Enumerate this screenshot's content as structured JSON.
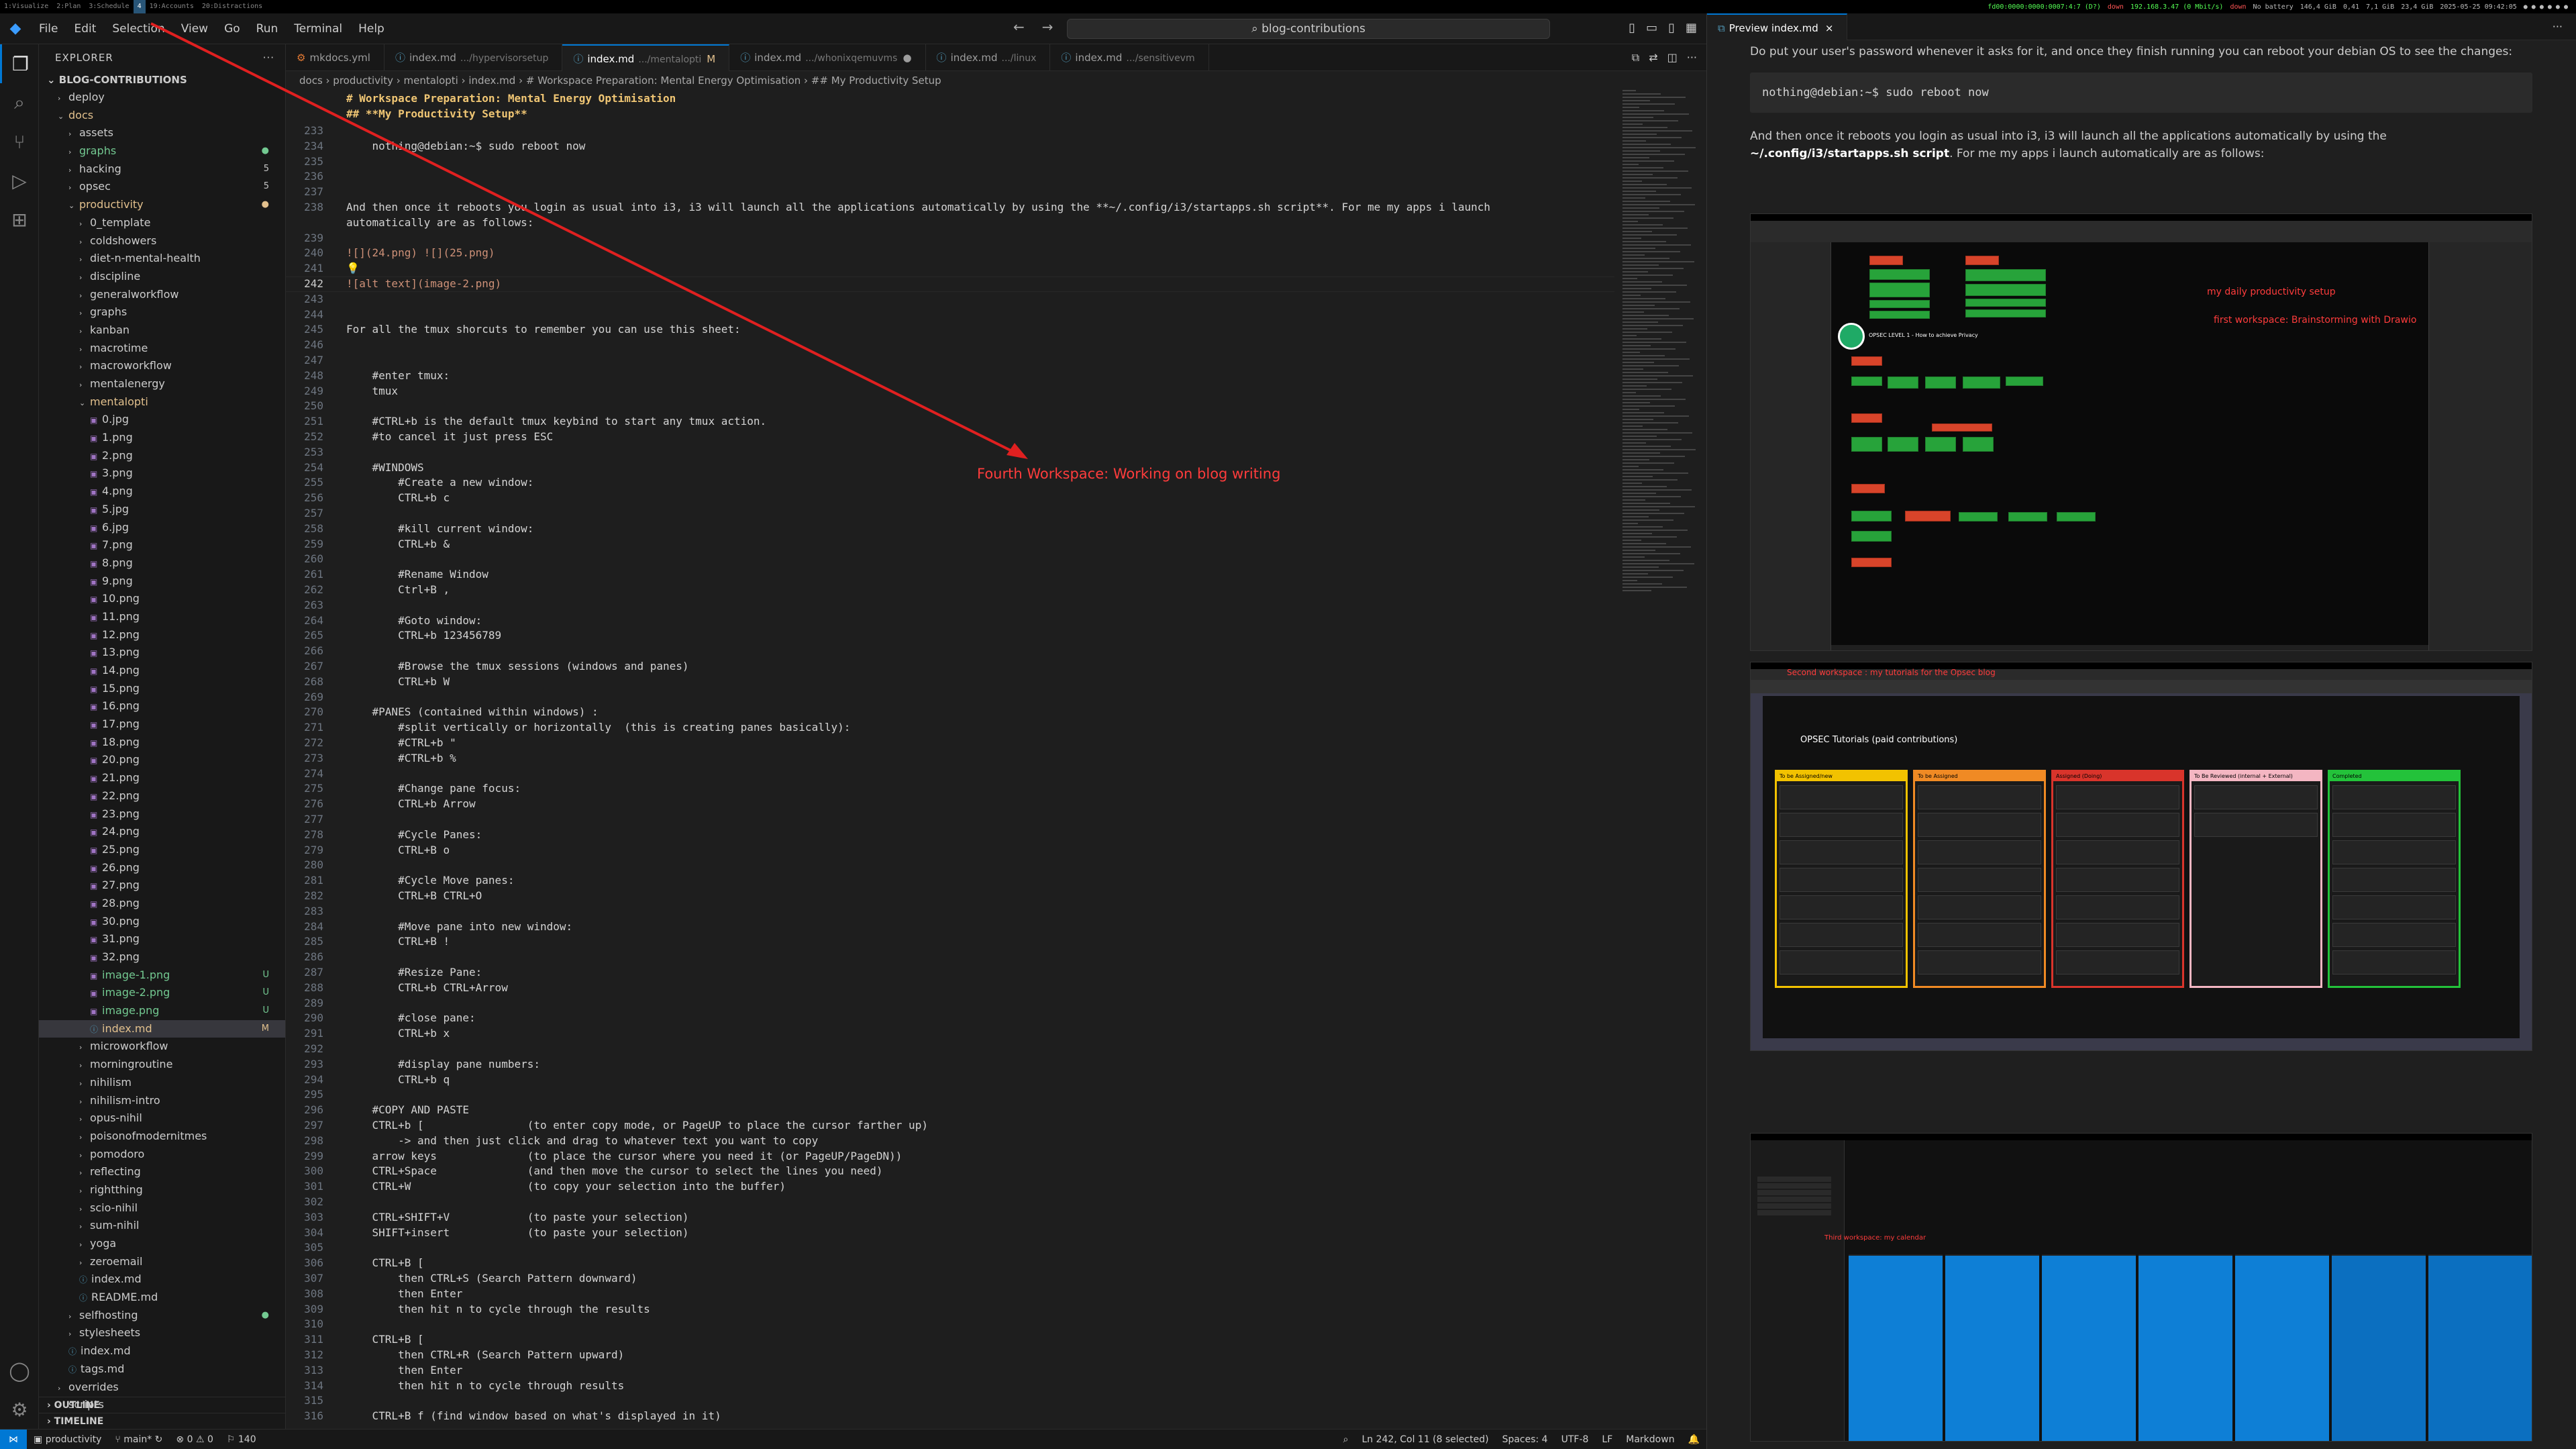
{
  "i3bar": {
    "workspaces": [
      {
        "label": "1:Visualize"
      },
      {
        "label": "2:Plan"
      },
      {
        "label": "3:Schedule"
      },
      {
        "label": "4",
        "active": true
      },
      {
        "label": "19:Accounts"
      },
      {
        "label": "20:Distractions"
      }
    ],
    "status": {
      "ip_down": "fd00:0000:0000:0007:4:7 (D?)",
      "down": "down",
      "ip_up": "192.168.3.47 (0 Mbit/s)",
      "down2": "down",
      "battery": "No battery",
      "disk": "146,4 GiB",
      "load": "0,41",
      "mem1": "7,1 GiB",
      "mem2": "23,4 GiB",
      "datetime": "2025-05-25 09:42:05"
    }
  },
  "titlebar": {
    "menu": [
      "File",
      "Edit",
      "Selection",
      "View",
      "Go",
      "Run",
      "Terminal",
      "Help"
    ],
    "command_center": "blog-contributions"
  },
  "sidebar": {
    "title": "EXPLORER",
    "root": "BLOG-CONTRIBUTIONS",
    "items": [
      {
        "label": "deploy",
        "depth": 1,
        "type": "folder",
        "open": false
      },
      {
        "label": "docs",
        "depth": 1,
        "type": "folder",
        "open": true,
        "color": "mod"
      },
      {
        "label": "assets",
        "depth": 2,
        "type": "folder",
        "open": false
      },
      {
        "label": "graphs",
        "depth": 2,
        "type": "folder",
        "open": false,
        "color": "ok",
        "badge": "●"
      },
      {
        "label": "hacking",
        "depth": 2,
        "type": "folder",
        "open": false,
        "badge": "5"
      },
      {
        "label": "opsec",
        "depth": 2,
        "type": "folder",
        "open": false,
        "badge": "5"
      },
      {
        "label": "productivity",
        "depth": 2,
        "type": "folder",
        "open": true,
        "color": "mod",
        "badge": "●"
      },
      {
        "label": "0_template",
        "depth": 3,
        "type": "folder",
        "open": false
      },
      {
        "label": "coldshowers",
        "depth": 3,
        "type": "folder",
        "open": false
      },
      {
        "label": "diet-n-mental-health",
        "depth": 3,
        "type": "folder",
        "open": false
      },
      {
        "label": "discipline",
        "depth": 3,
        "type": "folder",
        "open": false
      },
      {
        "label": "generalworkflow",
        "depth": 3,
        "type": "folder",
        "open": false
      },
      {
        "label": "graphs",
        "depth": 3,
        "type": "folder",
        "open": false
      },
      {
        "label": "kanban",
        "depth": 3,
        "type": "folder",
        "open": false
      },
      {
        "label": "macrotime",
        "depth": 3,
        "type": "folder",
        "open": false
      },
      {
        "label": "macroworkflow",
        "depth": 3,
        "type": "folder",
        "open": false
      },
      {
        "label": "mentalenergy",
        "depth": 3,
        "type": "folder",
        "open": false
      },
      {
        "label": "mentalopti",
        "depth": 3,
        "type": "folder",
        "open": true,
        "color": "mod"
      },
      {
        "label": "0.jpg",
        "depth": 4,
        "type": "img"
      },
      {
        "label": "1.png",
        "depth": 4,
        "type": "img"
      },
      {
        "label": "2.png",
        "depth": 4,
        "type": "img"
      },
      {
        "label": "3.png",
        "depth": 4,
        "type": "img"
      },
      {
        "label": "4.png",
        "depth": 4,
        "type": "img"
      },
      {
        "label": "5.jpg",
        "depth": 4,
        "type": "img"
      },
      {
        "label": "6.jpg",
        "depth": 4,
        "type": "img"
      },
      {
        "label": "7.png",
        "depth": 4,
        "type": "img"
      },
      {
        "label": "8.png",
        "depth": 4,
        "type": "img"
      },
      {
        "label": "9.png",
        "depth": 4,
        "type": "img"
      },
      {
        "label": "10.png",
        "depth": 4,
        "type": "img"
      },
      {
        "label": "11.png",
        "depth": 4,
        "type": "img"
      },
      {
        "label": "12.png",
        "depth": 4,
        "type": "img"
      },
      {
        "label": "13.png",
        "depth": 4,
        "type": "img"
      },
      {
        "label": "14.png",
        "depth": 4,
        "type": "img"
      },
      {
        "label": "15.png",
        "depth": 4,
        "type": "img"
      },
      {
        "label": "16.png",
        "depth": 4,
        "type": "img"
      },
      {
        "label": "17.png",
        "depth": 4,
        "type": "img"
      },
      {
        "label": "18.png",
        "depth": 4,
        "type": "img"
      },
      {
        "label": "20.png",
        "depth": 4,
        "type": "img"
      },
      {
        "label": "21.png",
        "depth": 4,
        "type": "img"
      },
      {
        "label": "22.png",
        "depth": 4,
        "type": "img"
      },
      {
        "label": "23.png",
        "depth": 4,
        "type": "img"
      },
      {
        "label": "24.png",
        "depth": 4,
        "type": "img"
      },
      {
        "label": "25.png",
        "depth": 4,
        "type": "img"
      },
      {
        "label": "26.png",
        "depth": 4,
        "type": "img"
      },
      {
        "label": "27.png",
        "depth": 4,
        "type": "img"
      },
      {
        "label": "28.png",
        "depth": 4,
        "type": "img"
      },
      {
        "label": "30.png",
        "depth": 4,
        "type": "img"
      },
      {
        "label": "31.png",
        "depth": 4,
        "type": "img"
      },
      {
        "label": "32.png",
        "depth": 4,
        "type": "img"
      },
      {
        "label": "image-1.png",
        "depth": 4,
        "type": "img",
        "color": "untr",
        "badge": "U"
      },
      {
        "label": "image-2.png",
        "depth": 4,
        "type": "img",
        "color": "untr",
        "badge": "U"
      },
      {
        "label": "image.png",
        "depth": 4,
        "type": "img",
        "color": "untr",
        "badge": "U"
      },
      {
        "label": "index.md",
        "depth": 4,
        "type": "md",
        "color": "mod",
        "badge": "M",
        "selected": true
      },
      {
        "label": "microworkflow",
        "depth": 3,
        "type": "folder",
        "open": false
      },
      {
        "label": "morningroutine",
        "depth": 3,
        "type": "folder",
        "open": false
      },
      {
        "label": "nihilism",
        "depth": 3,
        "type": "folder",
        "open": false
      },
      {
        "label": "nihilism-intro",
        "depth": 3,
        "type": "folder",
        "open": false
      },
      {
        "label": "opus-nihil",
        "depth": 3,
        "type": "folder",
        "open": false
      },
      {
        "label": "poisonofmodernitmes",
        "depth": 3,
        "type": "folder",
        "open": false
      },
      {
        "label": "pomodoro",
        "depth": 3,
        "type": "folder",
        "open": false
      },
      {
        "label": "reflecting",
        "depth": 3,
        "type": "folder",
        "open": false
      },
      {
        "label": "rightthing",
        "depth": 3,
        "type": "folder",
        "open": false
      },
      {
        "label": "scio-nihil",
        "depth": 3,
        "type": "folder",
        "open": false
      },
      {
        "label": "sum-nihil",
        "depth": 3,
        "type": "folder",
        "open": false
      },
      {
        "label": "yoga",
        "depth": 3,
        "type": "folder",
        "open": false
      },
      {
        "label": "zeroemail",
        "depth": 3,
        "type": "folder",
        "open": false
      },
      {
        "label": "index.md",
        "depth": 3,
        "type": "md"
      },
      {
        "label": "README.md",
        "depth": 3,
        "type": "md"
      },
      {
        "label": "selfhosting",
        "depth": 2,
        "type": "folder",
        "open": false,
        "badge": "●"
      },
      {
        "label": "stylesheets",
        "depth": 2,
        "type": "folder",
        "open": false
      },
      {
        "label": "index.md",
        "depth": 2,
        "type": "md"
      },
      {
        "label": "tags.md",
        "depth": 2,
        "type": "md"
      },
      {
        "label": "overrides",
        "depth": 1,
        "type": "folder",
        "open": false
      },
      {
        "label": "scripts",
        "depth": 1,
        "type": "folder",
        "open": false
      }
    ],
    "outline": "OUTLINE",
    "timeline": "TIMELINE"
  },
  "tabs": [
    {
      "label": "mkdocs.yml",
      "dir": "",
      "icon": "⚙"
    },
    {
      "label": "index.md",
      "dir": ".../hypervisorsetup",
      "icon": "ⓘ"
    },
    {
      "label": "index.md",
      "dir": ".../mentalopti",
      "icon": "ⓘ",
      "active": true,
      "mark": "M"
    },
    {
      "label": "index.md",
      "dir": ".../whonixqemuvms",
      "icon": "ⓘ",
      "dirty": true
    },
    {
      "label": "index.md",
      "dir": ".../linux",
      "icon": "ⓘ"
    },
    {
      "label": "index.md",
      "dir": ".../sensitivevm",
      "icon": "ⓘ"
    }
  ],
  "breadcrumb": "docs › productivity › mentalopti › index.md › # Workspace Preparation: Mental Energy Optimisation › ## My Productivity Setup",
  "sticky": [
    {
      "text": "# Workspace Preparation: Mental Energy Optimisation"
    },
    {
      "text": "## **My Productivity Setup**"
    }
  ],
  "editor_lines": [
    {
      "n": "233",
      "t": ""
    },
    {
      "n": "234",
      "t": "    nothing@debian:~$ sudo reboot now"
    },
    {
      "n": "235",
      "t": ""
    },
    {
      "n": "236",
      "t": ""
    },
    {
      "n": "237",
      "t": ""
    },
    {
      "n": "238",
      "t": "And then once it reboots you login as usual into i3, i3 will launch all the applications automatically by using the **~/.config/i3/startapps.sh script**. For me my apps i launch"
    },
    {
      "n": "",
      "t": "automatically are as follows:"
    },
    {
      "n": "239",
      "t": ""
    },
    {
      "n": "240",
      "t": "![](24.png) ![](25.png)"
    },
    {
      "n": "241",
      "t": "💡"
    },
    {
      "n": "242",
      "t": "![alt text](image-2.png)",
      "cur": true
    },
    {
      "n": "243",
      "t": ""
    },
    {
      "n": "244",
      "t": ""
    },
    {
      "n": "245",
      "t": "For all the tmux shorcuts to remember you can use this sheet:"
    },
    {
      "n": "246",
      "t": ""
    },
    {
      "n": "247",
      "t": ""
    },
    {
      "n": "248",
      "t": "    #enter tmux:"
    },
    {
      "n": "249",
      "t": "    tmux"
    },
    {
      "n": "250",
      "t": ""
    },
    {
      "n": "251",
      "t": "    #CTRL+b is the default tmux keybind to start any tmux action."
    },
    {
      "n": "252",
      "t": "    #to cancel it just press ESC"
    },
    {
      "n": "253",
      "t": ""
    },
    {
      "n": "254",
      "t": "    #WINDOWS"
    },
    {
      "n": "255",
      "t": "        #Create a new window:"
    },
    {
      "n": "256",
      "t": "        CTRL+b c"
    },
    {
      "n": "257",
      "t": ""
    },
    {
      "n": "258",
      "t": "        #kill current window:"
    },
    {
      "n": "259",
      "t": "        CTRL+b &"
    },
    {
      "n": "260",
      "t": ""
    },
    {
      "n": "261",
      "t": "        #Rename Window"
    },
    {
      "n": "262",
      "t": "        Ctrl+B ,"
    },
    {
      "n": "263",
      "t": ""
    },
    {
      "n": "264",
      "t": "        #Goto window:"
    },
    {
      "n": "265",
      "t": "        CTRL+b 123456789"
    },
    {
      "n": "266",
      "t": ""
    },
    {
      "n": "267",
      "t": "        #Browse the tmux sessions (windows and panes)"
    },
    {
      "n": "268",
      "t": "        CTRL+b W"
    },
    {
      "n": "269",
      "t": ""
    },
    {
      "n": "270",
      "t": "    #PANES (contained within windows) :"
    },
    {
      "n": "271",
      "t": "        #split vertically or horizontally  (this is creating panes basically):"
    },
    {
      "n": "272",
      "t": "        #CTRL+b \""
    },
    {
      "n": "273",
      "t": "        #CTRL+b %"
    },
    {
      "n": "274",
      "t": ""
    },
    {
      "n": "275",
      "t": "        #Change pane focus:"
    },
    {
      "n": "276",
      "t": "        CTRL+b Arrow"
    },
    {
      "n": "277",
      "t": ""
    },
    {
      "n": "278",
      "t": "        #Cycle Panes:"
    },
    {
      "n": "279",
      "t": "        CTRL+B o"
    },
    {
      "n": "280",
      "t": ""
    },
    {
      "n": "281",
      "t": "        #Cycle Move panes:"
    },
    {
      "n": "282",
      "t": "        CTRL+B CTRL+O"
    },
    {
      "n": "283",
      "t": ""
    },
    {
      "n": "284",
      "t": "        #Move pane into new window:"
    },
    {
      "n": "285",
      "t": "        CTRL+B !"
    },
    {
      "n": "286",
      "t": ""
    },
    {
      "n": "287",
      "t": "        #Resize Pane:"
    },
    {
      "n": "288",
      "t": "        CTRL+b CTRL+Arrow"
    },
    {
      "n": "289",
      "t": ""
    },
    {
      "n": "290",
      "t": "        #close pane:"
    },
    {
      "n": "291",
      "t": "        CTRL+b x"
    },
    {
      "n": "292",
      "t": ""
    },
    {
      "n": "293",
      "t": "        #display pane numbers:"
    },
    {
      "n": "294",
      "t": "        CTRL+b q"
    },
    {
      "n": "295",
      "t": ""
    },
    {
      "n": "296",
      "t": "    #COPY AND PASTE"
    },
    {
      "n": "297",
      "t": "    CTRL+b [                (to enter copy mode, or PageUP to place the cursor farther up)"
    },
    {
      "n": "298",
      "t": "        -> and then just click and drag to whatever text you want to copy"
    },
    {
      "n": "299",
      "t": "    arrow keys              (to place the cursor where you need it (or PageUP/PageDN))"
    },
    {
      "n": "300",
      "t": "    CTRL+Space              (and then move the cursor to select the lines you need)"
    },
    {
      "n": "301",
      "t": "    CTRL+W                  (to copy your selection into the buffer)"
    },
    {
      "n": "302",
      "t": ""
    },
    {
      "n": "303",
      "t": "    CTRL+SHIFT+V            (to paste your selection)"
    },
    {
      "n": "304",
      "t": "    SHIFT+insert            (to paste your selection)"
    },
    {
      "n": "305",
      "t": ""
    },
    {
      "n": "306",
      "t": "    CTRL+B ["
    },
    {
      "n": "307",
      "t": "        then CTRL+S (Search Pattern downward)"
    },
    {
      "n": "308",
      "t": "        then Enter"
    },
    {
      "n": "309",
      "t": "        then hit n to cycle through the results"
    },
    {
      "n": "310",
      "t": ""
    },
    {
      "n": "311",
      "t": "    CTRL+B ["
    },
    {
      "n": "312",
      "t": "        then CTRL+R (Search Pattern upward)"
    },
    {
      "n": "313",
      "t": "        then Enter"
    },
    {
      "n": "314",
      "t": "        then hit n to cycle through results"
    },
    {
      "n": "315",
      "t": ""
    },
    {
      "n": "316",
      "t": "    CTRL+B f (find window based on what's displayed in it)"
    }
  ],
  "annotation": "Fourth Workspace: Working on blog writing",
  "statusbar": {
    "branch": "main*",
    "project": "productivity",
    "problems": "⊗ 0 ⚠ 0",
    "ports": "140",
    "position": "Ln 242, Col 11 (8 selected)",
    "spaces": "Spaces: 4",
    "encoding": "UTF-8",
    "eol": "LF",
    "lang": "Markdown"
  },
  "preview": {
    "tab": "Preview index.md",
    "p1": "Do put your user's password whenever it asks for it, and once they finish running you can reboot your debian OS to see the changes:",
    "code": "nothing@debian:~$ sudo reboot now",
    "p2a": "And then once it reboots you login as usual into i3, i3 will launch all the applications automatically by using the",
    "p2b": "~/.config/i3/startapps.sh script",
    "p2c": ". For me my apps i launch automatically are as follows:",
    "shot1": {
      "notes": [
        "my daily productivity setup",
        "first workspace: Brainstorming with Drawio"
      ],
      "title": "OPSEC LEVEL 1 - How to achieve Privacy"
    },
    "shot2": {
      "note": "Second workspace : my tutorials for the Opsec blog",
      "heading": "OPSEC Tutorials (paid contributions)",
      "columns": [
        {
          "name": "To be Assigned/new",
          "color": "#f2c200"
        },
        {
          "name": "To be Assigned",
          "color": "#f08a24"
        },
        {
          "name": "Assigned (Doing)",
          "color": "#d9342b"
        },
        {
          "name": "To Be Reviewed (internal + External)",
          "color": "#f4b6c2"
        },
        {
          "name": "Completed",
          "color": "#23c23a"
        }
      ]
    },
    "shot3": {
      "note": "Third workspace: my calendar"
    }
  }
}
